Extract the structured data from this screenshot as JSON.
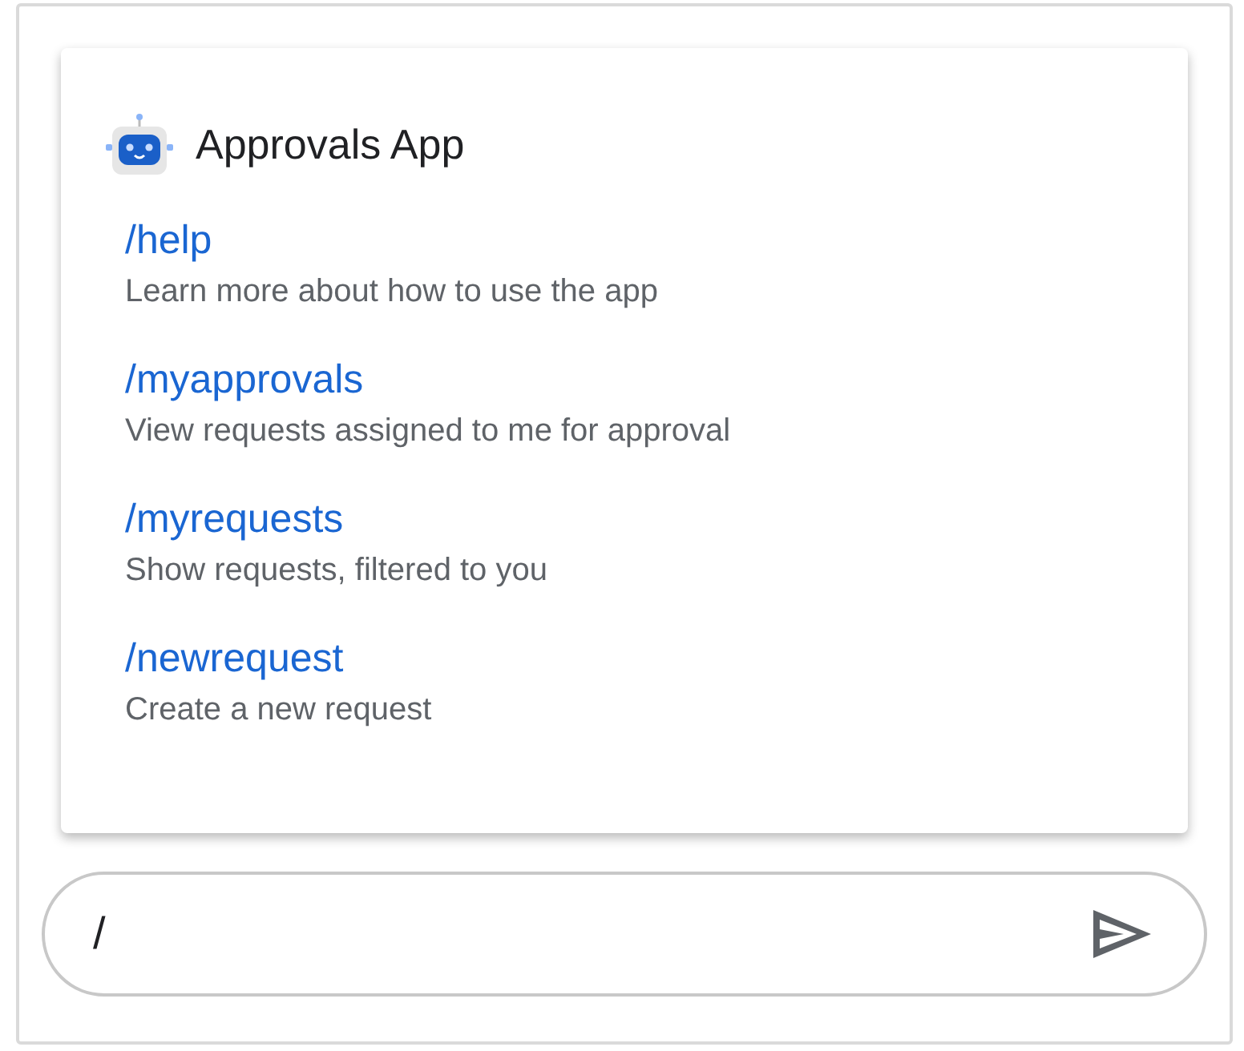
{
  "app": {
    "name": "Approvals App"
  },
  "commands": [
    {
      "command": "/help",
      "description": "Learn more about how to use the app"
    },
    {
      "command": "/myapprovals",
      "description": "View requests assigned to me for approval"
    },
    {
      "command": "/myrequests",
      "description": "Show requests, filtered to you"
    },
    {
      "command": "/newrequest",
      "description": "Create a new request"
    }
  ],
  "composer": {
    "value": "/"
  }
}
